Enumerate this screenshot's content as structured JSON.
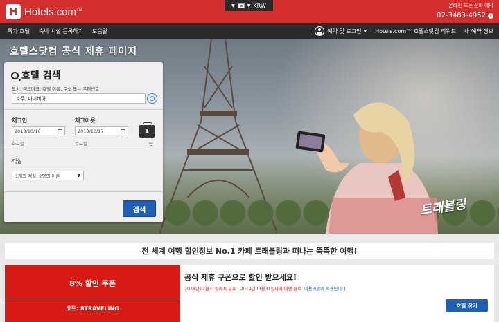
{
  "header": {
    "brand": "Hotels.com",
    "brand_mark": "TM",
    "logo_letter": "H",
    "locale_currency": "KRW",
    "contact_label": "온라인 또는 전화 예약",
    "contact_phone": "02-3483-4952",
    "accent_color": "#d32f2f"
  },
  "nav": {
    "left": [
      "특가 호텔",
      "숙박 시설 등록하기",
      "도움말"
    ],
    "right": [
      "예약 및 로그인",
      "Hotels.com™ 호텔스닷컴 리워드",
      "내 예약 정보"
    ]
  },
  "hero": {
    "title": "호텔스닷컴 공식 제휴 페이지",
    "brand_logo": "트래블링"
  },
  "search": {
    "title": "호텔 검색",
    "dest_label": "도시, 랜드마크, 호텔 이름, 주소 또는 우편번호",
    "dest_value": "호주, 나미비아",
    "checkin_label": "체크인",
    "checkin_value": "2018/10/16",
    "checkin_day": "화요일",
    "checkout_label": "체크아웃",
    "checkout_value": "2018/10/17",
    "checkout_day": "수요일",
    "nights_value": "1",
    "nights_unit": "박",
    "rooms_label": "객실",
    "rooms_value": "1개의 객실, 2명의 어른",
    "button_label": "검색"
  },
  "tagline": "전 세계 여행 할인정보 No.1 카페 트래블링과 떠나는 뜩뜩한 여행!",
  "coupon": {
    "discount": "8% 할인 쿠폰",
    "code": "코드: 8TRAVELING",
    "headline": "공식 제휴 쿠폰으로  할인 받으세요!",
    "terms": "2018년12월31일까지 유효 | 2019년03월31일까지 여행 완료",
    "terms_link": "이용약관이 적용됩니다",
    "button_label": "호텔 찾기"
  }
}
